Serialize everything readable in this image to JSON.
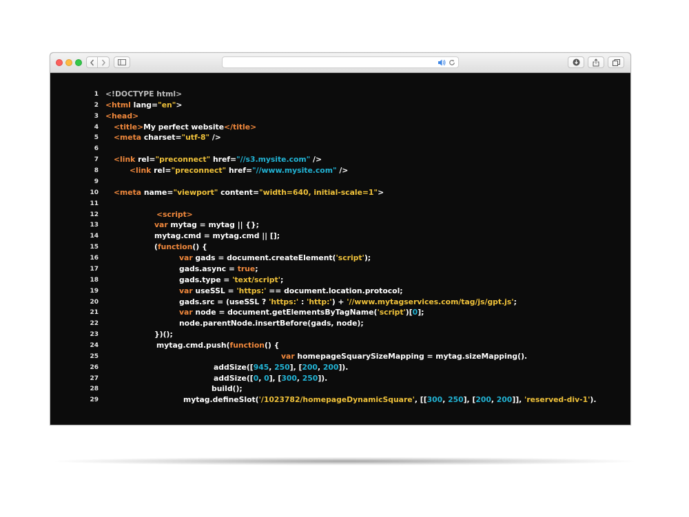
{
  "browser": {
    "address_text": "",
    "icons": {
      "back": "chevron-left-icon",
      "forward": "chevron-right-icon",
      "sidebar": "sidebar-icon",
      "audio": "speaker-icon",
      "reload": "reload-icon",
      "download": "download-icon",
      "share": "share-icon",
      "tabs": "tabs-icon"
    }
  },
  "colors": {
    "tag": "#f0883c",
    "string": "#f0c23a",
    "url": "#22b3d4",
    "number": "#22b3d4",
    "background": "#0c0c0c"
  },
  "code": {
    "lines": [
      {
        "n": "1",
        "indent": "0",
        "parts": [
          {
            "t": "<!DOCTYPE html>",
            "c": "gray"
          }
        ]
      },
      {
        "n": "2",
        "indent": "0",
        "parts": [
          {
            "t": "<html",
            "c": "tag"
          },
          {
            "t": " lang=",
            "c": ""
          },
          {
            "t": "\"en\"",
            "c": "str"
          },
          {
            "t": ">",
            "c": ""
          }
        ]
      },
      {
        "n": "3",
        "indent": "0",
        "parts": [
          {
            "t": "<head>",
            "c": "tag"
          }
        ]
      },
      {
        "n": "4",
        "indent": "1",
        "parts": [
          {
            "t": "<title>",
            "c": "tag"
          },
          {
            "t": "My perfect website",
            "c": ""
          },
          {
            "t": "</title>",
            "c": "tag"
          }
        ]
      },
      {
        "n": "5",
        "indent": "1",
        "parts": [
          {
            "t": "<meta",
            "c": "tag"
          },
          {
            "t": " charset=",
            "c": ""
          },
          {
            "t": "\"utf-8\"",
            "c": "str"
          },
          {
            "t": " />",
            "c": ""
          }
        ]
      },
      {
        "n": "6",
        "indent": "0",
        "parts": []
      },
      {
        "n": "7",
        "indent": "1",
        "parts": [
          {
            "t": "<link",
            "c": "tag"
          },
          {
            "t": " rel=",
            "c": ""
          },
          {
            "t": "\"preconnect\"",
            "c": "str"
          },
          {
            "t": " href=",
            "c": ""
          },
          {
            "t": "\"//s3.mysite.com\"",
            "c": "url"
          },
          {
            "t": " />",
            "c": ""
          }
        ]
      },
      {
        "n": "8",
        "indent": "3",
        "parts": [
          {
            "t": "<link",
            "c": "tag"
          },
          {
            "t": " rel=",
            "c": ""
          },
          {
            "t": "\"preconnect\"",
            "c": "str"
          },
          {
            "t": " href=",
            "c": ""
          },
          {
            "t": "\"//www.mysite.com\"",
            "c": "url"
          },
          {
            "t": " />",
            "c": ""
          }
        ]
      },
      {
        "n": "9",
        "indent": "0",
        "parts": []
      },
      {
        "n": "10",
        "indent": "1",
        "parts": [
          {
            "t": "<meta",
            "c": "tag"
          },
          {
            "t": " name=",
            "c": ""
          },
          {
            "t": "\"viewport\"",
            "c": "str"
          },
          {
            "t": " content=",
            "c": ""
          },
          {
            "t": "\"width=640, initial-scale=1\"",
            "c": "str"
          },
          {
            "t": ">",
            "c": ""
          }
        ]
      },
      {
        "n": "11",
        "indent": "0",
        "parts": []
      },
      {
        "n": "12",
        "indent": "6",
        "parts": [
          {
            "t": "<script>",
            "c": "tag"
          }
        ]
      },
      {
        "n": "13",
        "indent": "5",
        "parts": [
          {
            "t": "var",
            "c": "kw"
          },
          {
            "t": " mytag = mytag || {};",
            "c": ""
          }
        ]
      },
      {
        "n": "14",
        "indent": "5",
        "parts": [
          {
            "t": "mytag.cmd = mytag.cmd || [];",
            "c": ""
          }
        ]
      },
      {
        "n": "15",
        "indent": "5",
        "parts": [
          {
            "t": "(",
            "c": ""
          },
          {
            "t": "function",
            "c": "kw"
          },
          {
            "t": "() {",
            "c": ""
          }
        ]
      },
      {
        "n": "16",
        "indent": "8",
        "parts": [
          {
            "t": "var",
            "c": "kw"
          },
          {
            "t": " gads = document.createElement(",
            "c": ""
          },
          {
            "t": "'script'",
            "c": "str"
          },
          {
            "t": ");",
            "c": ""
          }
        ]
      },
      {
        "n": "17",
        "indent": "8",
        "parts": [
          {
            "t": "gads.async = ",
            "c": ""
          },
          {
            "t": "true",
            "c": "kw"
          },
          {
            "t": ";",
            "c": ""
          }
        ]
      },
      {
        "n": "18",
        "indent": "8",
        "parts": [
          {
            "t": "gads.type = ",
            "c": ""
          },
          {
            "t": "'text/script'",
            "c": "str"
          },
          {
            "t": ";",
            "c": ""
          }
        ]
      },
      {
        "n": "19",
        "indent": "8",
        "parts": [
          {
            "t": "var",
            "c": "kw"
          },
          {
            "t": " useSSL = ",
            "c": ""
          },
          {
            "t": "'https:'",
            "c": "str"
          },
          {
            "t": " == document.location.protocol;",
            "c": ""
          }
        ]
      },
      {
        "n": "20",
        "indent": "8",
        "parts": [
          {
            "t": "gads.src = (useSSL ? ",
            "c": ""
          },
          {
            "t": "'https:'",
            "c": "str"
          },
          {
            "t": " : ",
            "c": ""
          },
          {
            "t": "'http:'",
            "c": "str"
          },
          {
            "t": ") + ",
            "c": ""
          },
          {
            "t": "'//www.mytagservices.com/tag/js/gpt.js'",
            "c": "str"
          },
          {
            "t": ";",
            "c": ""
          }
        ]
      },
      {
        "n": "21",
        "indent": "8",
        "parts": [
          {
            "t": "var",
            "c": "kw"
          },
          {
            "t": " node = document.getElementsByTagName(",
            "c": ""
          },
          {
            "t": "'script'",
            "c": "str"
          },
          {
            "t": ")[",
            "c": ""
          },
          {
            "t": "0",
            "c": "num"
          },
          {
            "t": "];",
            "c": ""
          }
        ]
      },
      {
        "n": "22",
        "indent": "8",
        "parts": [
          {
            "t": "node.parentNode.insertBefore(gads, node);",
            "c": ""
          }
        ]
      },
      {
        "n": "23",
        "indent": "5",
        "parts": [
          {
            "t": "})();",
            "c": ""
          }
        ]
      },
      {
        "n": "24",
        "indent": "5b",
        "parts": [
          {
            "t": "mytag.cmd.push(",
            "c": ""
          },
          {
            "t": "function",
            "c": "kw"
          },
          {
            "t": "() {",
            "c": ""
          }
        ]
      },
      {
        "n": "25",
        "indent": "20",
        "parts": [
          {
            "t": "var",
            "c": "kw"
          },
          {
            "t": " homepageSquarySizeMapping = mytag.sizeMapping().",
            "c": ""
          }
        ]
      },
      {
        "n": "26",
        "indent": "12",
        "parts": [
          {
            "t": "addSize([",
            "c": ""
          },
          {
            "t": "945",
            "c": "num"
          },
          {
            "t": ", ",
            "c": ""
          },
          {
            "t": "250",
            "c": "num"
          },
          {
            "t": "], [",
            "c": ""
          },
          {
            "t": "200",
            "c": "num"
          },
          {
            "t": ", ",
            "c": ""
          },
          {
            "t": "200",
            "c": "num"
          },
          {
            "t": "]).",
            "c": ""
          }
        ]
      },
      {
        "n": "27",
        "indent": "12",
        "parts": [
          {
            "t": "addSize([",
            "c": ""
          },
          {
            "t": "0",
            "c": "num"
          },
          {
            "t": ", ",
            "c": ""
          },
          {
            "t": "0",
            "c": "num"
          },
          {
            "t": "], [",
            "c": ""
          },
          {
            "t": "300",
            "c": "num"
          },
          {
            "t": ", ",
            "c": ""
          },
          {
            "t": "250",
            "c": "num"
          },
          {
            "t": "]).",
            "c": ""
          }
        ]
      },
      {
        "n": "28",
        "indent": "12b",
        "parts": [
          {
            "t": "build();",
            "c": ""
          }
        ]
      },
      {
        "n": "29",
        "indent": "9",
        "parts": [
          {
            "t": "mytag.defineSlot(",
            "c": ""
          },
          {
            "t": "'/1023782/homepageDynamicSquare'",
            "c": "str"
          },
          {
            "t": ", [[",
            "c": ""
          },
          {
            "t": "300",
            "c": "num"
          },
          {
            "t": ", ",
            "c": ""
          },
          {
            "t": "250",
            "c": "num"
          },
          {
            "t": "], [",
            "c": ""
          },
          {
            "t": "200",
            "c": "num"
          },
          {
            "t": ", ",
            "c": ""
          },
          {
            "t": "200",
            "c": "num"
          },
          {
            "t": "]], ",
            "c": ""
          },
          {
            "t": "'reserved-div-1'",
            "c": "str"
          },
          {
            "t": ").",
            "c": ""
          }
        ]
      }
    ]
  }
}
